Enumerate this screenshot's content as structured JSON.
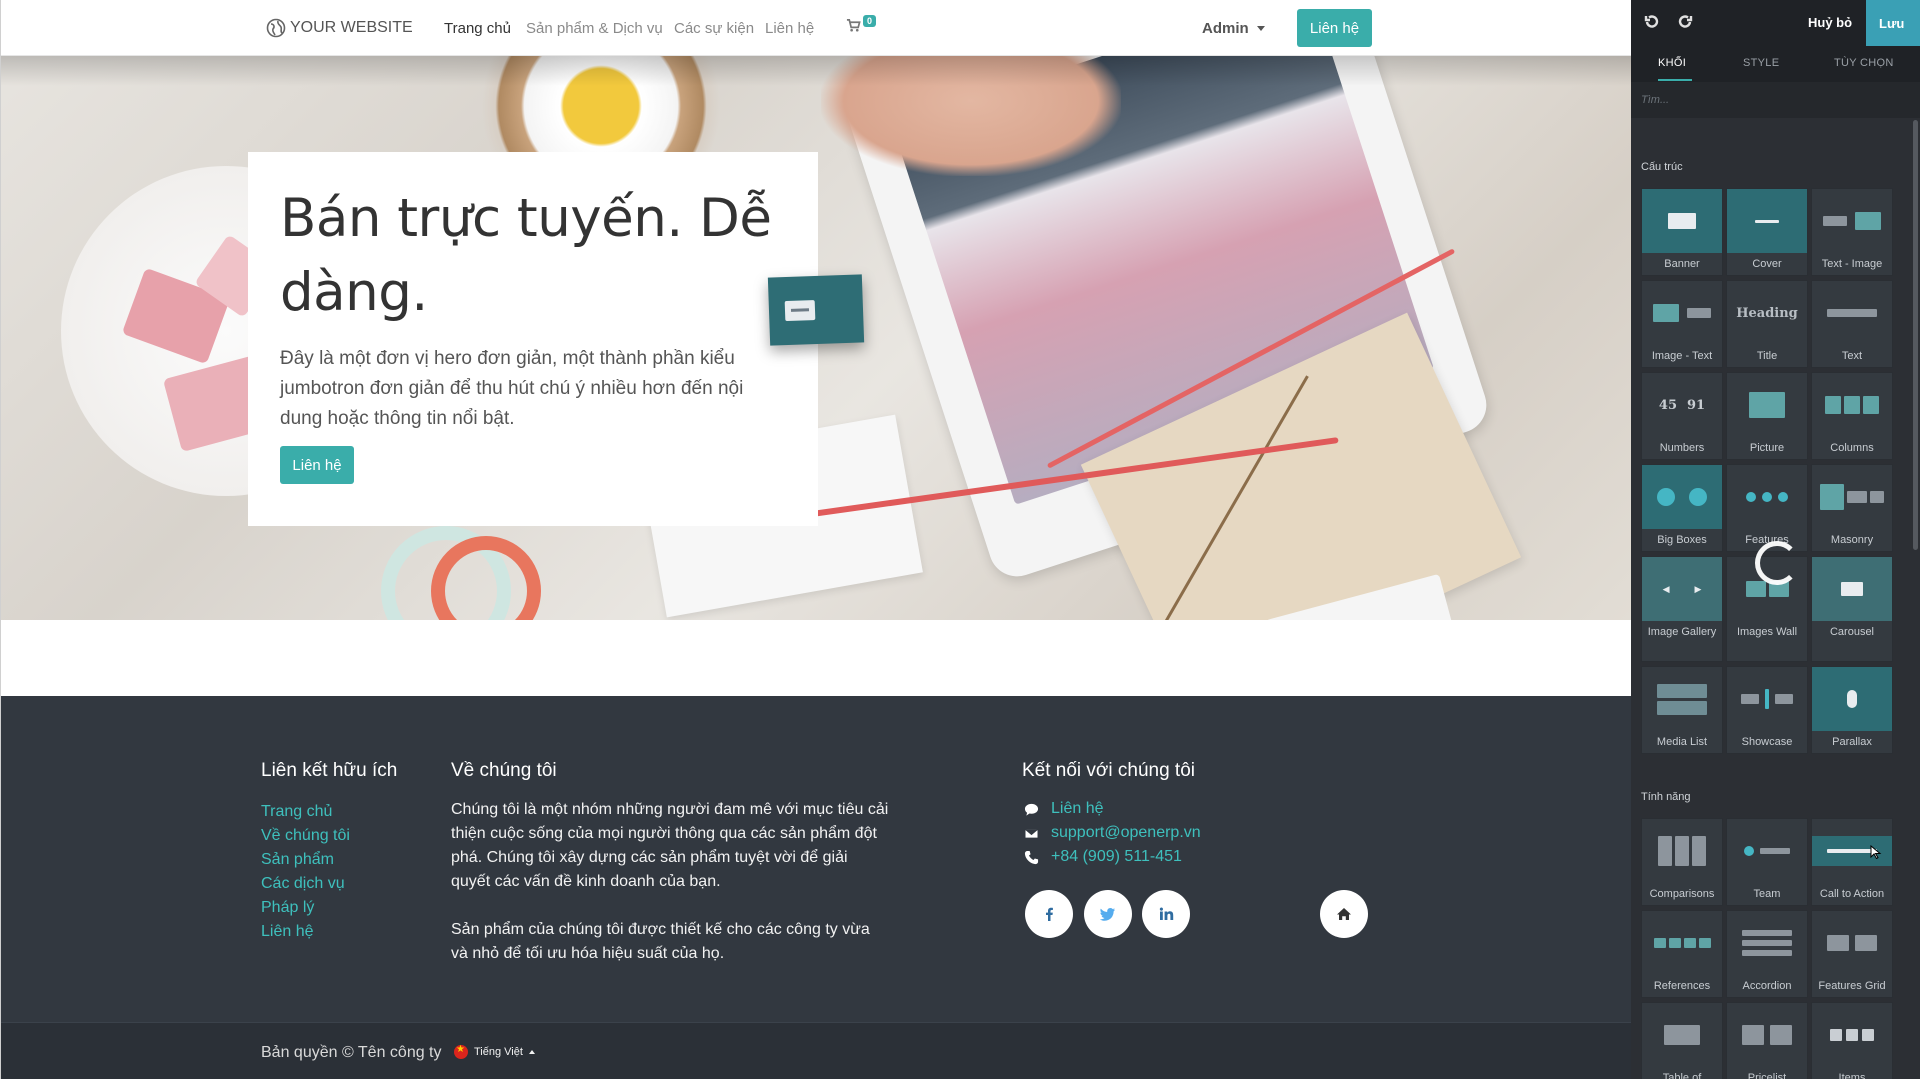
{
  "navbar": {
    "brand": "YOUR WEBSITE",
    "links": [
      "Trang chủ",
      "Sản phẩm & Dịch vụ",
      "Các sự kiện",
      "Liên hệ"
    ],
    "cart_count": "0",
    "user": "Admin",
    "cta": "Liên hệ"
  },
  "hero": {
    "title": "Bán trực tuyến. Dễ dàng.",
    "text": "Đây là một đơn vị hero đơn giản, một thành phần kiểu jumbotron đơn giản để thu hút chú ý nhiều hơn đến nội dung hoặc thông tin nổi bật.",
    "button": "Liên hệ"
  },
  "footer": {
    "links_heading": "Liên kết hữu ích",
    "links": [
      "Trang chủ",
      "Về chúng tôi",
      "Sản phẩm",
      "Các dịch vụ",
      "Pháp lý",
      "Liên hệ"
    ],
    "about_heading": "Về chúng tôi",
    "about_p1": "Chúng tôi là một nhóm những người đam mê với mục tiêu cải thiện cuộc sống của mọi người thông qua các sản phẩm đột phá. Chúng tôi xây dựng các sản phẩm tuyệt vời để giải quyết các vấn đề kinh doanh của bạn.",
    "about_p2": "Sản phẩm của chúng tôi được thiết kế cho các công ty vừa và nhỏ để tối ưu hóa hiệu suất của họ.",
    "connect_heading": "Kết nối với chúng tôi",
    "contact_link": "Liên hệ",
    "email": "support@openerp.vn",
    "phone": "+84 (909) 511-451",
    "copyright": "Bản quyền © Tên công ty",
    "language": "Tiếng Việt"
  },
  "panel": {
    "cancel": "Huỷ bỏ",
    "save": "Lưu",
    "tabs": [
      "KHỐI",
      "STYLE",
      "TÙY CHỌN"
    ],
    "search_placeholder": "Tìm...",
    "section_structure": "Cấu trúc",
    "section_features": "Tính năng",
    "structure_blocks": [
      "Banner",
      "Cover",
      "Text - Image",
      "Image - Text",
      "Title",
      "Text",
      "Numbers",
      "Picture",
      "Columns",
      "Big Boxes",
      "Features",
      "Masonry",
      "Image Gallery",
      "Images Wall",
      "Carousel",
      "Media List",
      "Showcase",
      "Parallax"
    ],
    "feature_blocks": [
      "Comparisons",
      "Team",
      "Call to Action",
      "References",
      "Accordion",
      "Features Grid",
      "Table of",
      "Pricelist",
      "Items"
    ],
    "thumb_heading": "Heading",
    "thumb_numbers": [
      "45",
      "91"
    ]
  },
  "colors": {
    "accent": "#3aadaa",
    "save_button": "#3aa0b5",
    "footer_bg": "#323840",
    "panel_bg": "#2c2f34"
  }
}
